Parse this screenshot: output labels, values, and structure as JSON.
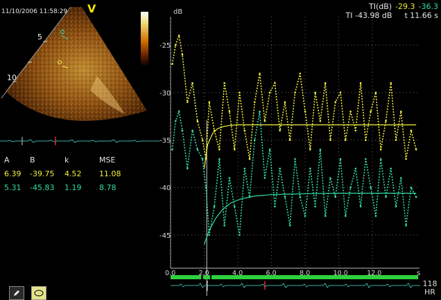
{
  "header": {
    "timestamp": "11/10/2006 11:58:29",
    "view_marker": "V",
    "ti_label": "TI(dB)",
    "ti_value_1": "-29.3",
    "ti_value_2": "-36.3",
    "ti_secondary": "TI -43.98 dB",
    "time_readout": "t 11.66 s"
  },
  "image_panel": {
    "depth_labels": [
      "5",
      "10"
    ]
  },
  "fit_params": {
    "headers": [
      "A",
      "B",
      "k",
      "MSE"
    ],
    "rows": [
      {
        "values": [
          "6.39",
          "-39.75",
          "4.52",
          "11.08"
        ],
        "color": "#f1ee3d"
      },
      {
        "values": [
          "5.31",
          "-45.83",
          "1.19",
          "8.78"
        ],
        "color": "#34dcaa"
      }
    ]
  },
  "heart_rate": {
    "value": "118",
    "label": "HR"
  },
  "tools": {
    "pencil_icon": "pencil-icon",
    "ellipse_icon": "ellipse-icon"
  },
  "chart_data": {
    "type": "line",
    "ylabel": "dB",
    "xlabel": "s",
    "xlim": [
      0,
      14.8
    ],
    "ylim": [
      -48.5,
      -22
    ],
    "xticks": [
      "0.0",
      "2.0",
      "4.0",
      "6.0",
      "8.0",
      "10.0",
      "12.0"
    ],
    "yticks": [
      "-25",
      "-30",
      "-35",
      "-40",
      "-45"
    ],
    "grid": true,
    "series": [
      {
        "color": "#f1ee3d",
        "style": "dotted",
        "x": [
          0.1,
          0.3,
          0.5,
          0.7,
          1.0,
          1.3,
          1.6,
          1.9,
          2.1,
          2.3,
          2.6,
          2.9,
          3.2,
          3.5,
          3.8,
          4.1,
          4.4,
          4.7,
          5.0,
          5.3,
          5.6,
          5.9,
          6.2,
          6.5,
          6.8,
          7.1,
          7.4,
          7.7,
          8.0,
          8.3,
          8.6,
          8.9,
          9.2,
          9.5,
          9.8,
          10.1,
          10.4,
          10.7,
          11.0,
          11.3,
          11.6,
          11.9,
          12.2,
          12.5,
          12.8,
          13.1,
          13.4,
          13.7,
          14.0,
          14.3,
          14.6
        ],
        "y": [
          -27,
          -25,
          -24,
          -26,
          -31,
          -29,
          -33,
          -35,
          -37,
          -31,
          -34,
          -36,
          -29,
          -32,
          -36,
          -30,
          -34,
          -37,
          -31,
          -28,
          -33,
          -30,
          -29,
          -34,
          -31,
          -35,
          -30,
          -28,
          -32,
          -36,
          -30,
          -33,
          -29,
          -35,
          -31,
          -30,
          -35,
          -32,
          -34,
          -29,
          -35,
          -32,
          -30,
          -36,
          -33,
          -29,
          -35,
          -32,
          -37,
          -34,
          -36
        ]
      },
      {
        "color": "#34dcaa",
        "style": "dotted",
        "x": [
          0.1,
          0.3,
          0.5,
          0.7,
          1.0,
          1.3,
          1.6,
          1.9,
          2.1,
          2.3,
          2.6,
          2.9,
          3.2,
          3.5,
          3.8,
          4.1,
          4.4,
          4.7,
          5.0,
          5.3,
          5.6,
          5.9,
          6.2,
          6.5,
          6.8,
          7.1,
          7.4,
          7.7,
          8.0,
          8.3,
          8.6,
          8.9,
          9.2,
          9.5,
          9.8,
          10.1,
          10.4,
          10.7,
          11.0,
          11.3,
          11.6,
          11.9,
          12.2,
          12.5,
          12.8,
          13.1,
          13.4,
          13.7,
          14.0,
          14.3,
          14.6
        ],
        "y": [
          -36,
          -33,
          -32,
          -34,
          -38,
          -34,
          -36,
          -37,
          -40,
          -45,
          -42,
          -37,
          -44,
          -39,
          -42,
          -45,
          -38,
          -41,
          -35,
          -32,
          -39,
          -36,
          -42,
          -38,
          -41,
          -44,
          -37,
          -41,
          -43,
          -38,
          -42,
          -36,
          -43,
          -39,
          -41,
          -37,
          -43,
          -40,
          -38,
          -42,
          -37,
          -40,
          -43,
          -37,
          -41,
          -38,
          -42,
          -39,
          -44,
          -40,
          -41
        ]
      },
      {
        "color": "#f1ee3d",
        "style": "fit",
        "x": [
          2.0,
          2.2,
          2.5,
          2.8,
          3.2,
          3.6,
          4.0,
          5.0,
          6.0,
          8.0,
          10.0,
          12.0,
          14.6
        ],
        "y": [
          -38,
          -35.5,
          -34.3,
          -33.8,
          -33.55,
          -33.45,
          -33.4,
          -33.4,
          -33.4,
          -33.4,
          -33.4,
          -33.4,
          -33.4
        ]
      },
      {
        "color": "#34dcaa",
        "style": "fit",
        "x": [
          2.0,
          2.3,
          2.7,
          3.1,
          3.6,
          4.2,
          5.0,
          6.0,
          7.0,
          8.0,
          10.0,
          12.0,
          14.6
        ],
        "y": [
          -46,
          -44.5,
          -43.2,
          -42.3,
          -41.6,
          -41.2,
          -40.9,
          -40.75,
          -40.7,
          -40.65,
          -40.6,
          -40.6,
          -40.6
        ]
      }
    ]
  }
}
